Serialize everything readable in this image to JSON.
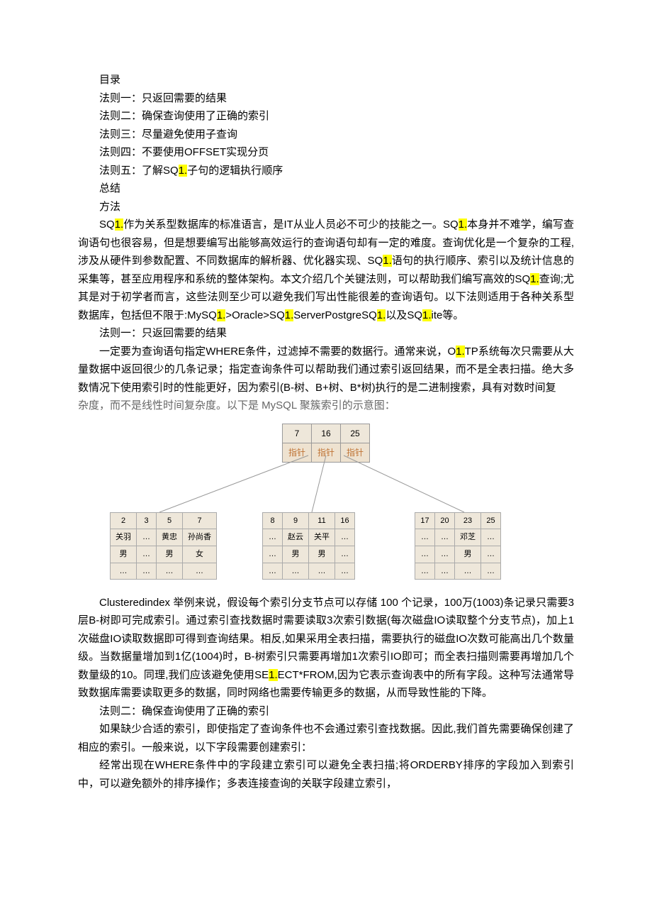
{
  "toc": {
    "title": "目录",
    "items": [
      "法则一：只返回需要的结果",
      "法则二：确保查询使用了正确的索引",
      "法则三：尽量避免使用子查询",
      "法则四：不要使用OFFSET实现分页",
      "总结",
      "方法"
    ],
    "rule5_pre": "法则五：了解SQ",
    "rule5_hl": "1.",
    "rule5_post": "子句的逻辑执行顺序"
  },
  "intro": {
    "p1_t1": "SQ",
    "p1_h1": "1.",
    "p1_t2": "作为关系型数据库的标准语言，是IT从业人员必不可少的技能之一。SQ",
    "p1_h2": "1.",
    "p1_t3": "本身并不难学，编写查询语句也很容易，但是想要编写出能够高效运行的查询语句却有一定的难度。查询优化是一个复杂的工程,涉及从硬件到参数配置、不同数据库的解析器、优化器实现、SQ",
    "p1_h3": "1.",
    "p1_t4": "语句的执行顺序、索引以及统计信息的采集等，甚至应用程序和系统的整体架构。本文介绍几个关键法则，可以帮助我们编写高效的SQ",
    "p1_h4": "1.",
    "p1_t5": "查询;尤其是对于初学者而言，这些法则至少可以避免我们写出性能很差的查询语句。以下法则适用于各种关系型数据库，包括但不限于:MySQ",
    "p1_h5": "1.",
    "p1_t6": ">Oracle>SQ",
    "p1_h6": "1.",
    "p1_t7": "ServerPostgreSQ",
    "p1_h7": "1.",
    "p1_t8": "以及SQ",
    "p1_h8": "1.",
    "p1_t9": "ite等。"
  },
  "rule1": {
    "header": "法则一：只返回需要的结果",
    "p1_t1": "一定要为查询语句指定WHERE条件，过滤掉不需要的数据行。通常来说，O",
    "p1_h1": "1.",
    "p1_t2": "TP系统每次只需要从大量数据中返回很少的几条记录；指定查询条件可以帮助我们通过索引返回结果，而不是全表扫描。绝大多数情况下使用索引时的性能更好，因为索引(B-树、B+树、B*树)执行的是二进制搜索，具有对数时间复",
    "p2": "杂度，而不是线性时间复杂度。以下是 MySQL 聚簇索引的示意图："
  },
  "diagram": {
    "root_keys": [
      "7",
      "16",
      "25"
    ],
    "root_ptrs": [
      "指针",
      "指针",
      "指针"
    ],
    "leaf1": [
      [
        "2",
        "3",
        "5",
        "7"
      ],
      [
        "关羽",
        "…",
        "黄忠",
        "孙尚香"
      ],
      [
        "男",
        "…",
        "男",
        "女"
      ],
      [
        "…",
        "…",
        "…",
        "…"
      ]
    ],
    "leaf2": [
      [
        "8",
        "9",
        "11",
        "16"
      ],
      [
        "…",
        "赵云",
        "关平",
        "…"
      ],
      [
        "…",
        "男",
        "男",
        "…"
      ],
      [
        "…",
        "…",
        "…",
        "…"
      ]
    ],
    "leaf3": [
      [
        "17",
        "20",
        "23",
        "25"
      ],
      [
        "…",
        "…",
        "邓芝",
        "…"
      ],
      [
        "…",
        "…",
        "男",
        "…"
      ],
      [
        "…",
        "…",
        "…",
        "…"
      ]
    ]
  },
  "after_diagram": {
    "p1_t1": "Clusteredindex 举例来说，假设每个索引分支节点可以存储 100 个记录，100万(1003)条记录只需要3层B-树即可完成索引。通过索引查找数据时需要读取3次索引数据(每次磁盘IO读取整个分支节点)，加上1次磁盘IO读取数据即可得到查询结果。相反,如果采用全表扫描，需要执行的磁盘IO次数可能高出几个数量级。当数据量增加到1亿(1004)时，B-树索引只需要再增加1次索引IO即可；而全表扫描则需要再增加几个数量级的10。同理,我们应该避免使用SE",
    "p1_h1": "1.",
    "p1_t2": "ECT*FROM,因为它表示查询表中的所有字段。这种写法通常导致数据库需要读取更多的数据，同时网络也需要传输更多的数据，从而导致性能的下降。"
  },
  "rule2": {
    "header": "法则二：确保查询使用了正确的索引",
    "p1": "如果缺少合适的索引，即使指定了查询条件也不会通过索引查找数据。因此,我们首先需要确保创建了相应的索引。一般来说，以下字段需要创建索引：",
    "p2": "经常出现在WHERE条件中的字段建立索引可以避免全表扫描;将ORDERBY排序的字段加入到索引中，可以避免额外的排序操作；多表连接查询的关联字段建立索引，"
  }
}
